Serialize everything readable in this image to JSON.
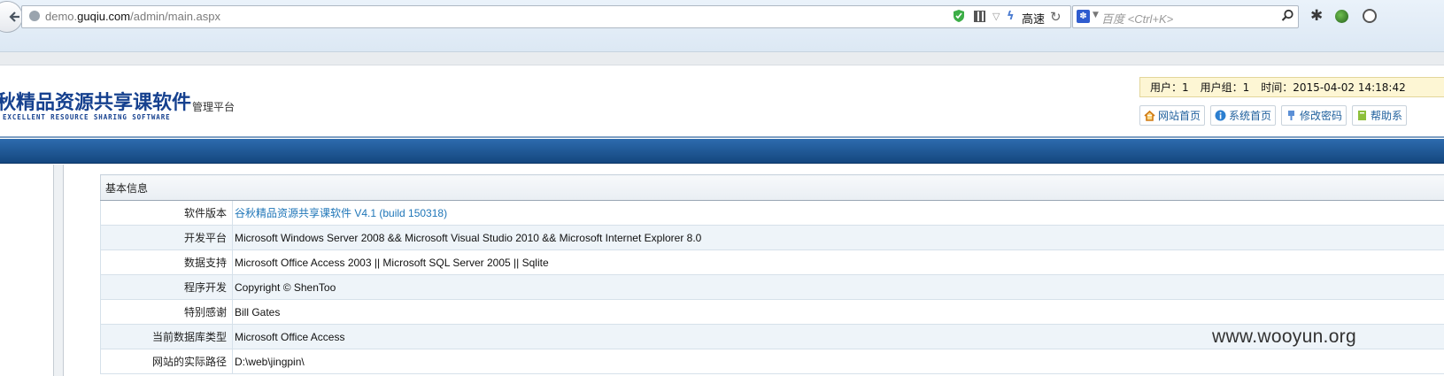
{
  "browser": {
    "url_prefix": "demo.",
    "url_domain": "guqiu.com",
    "url_path": "/admin/main.aspx",
    "speed_label": "高速",
    "search_placeholder": "百度 <Ctrl+K>",
    "icons": [
      "back-arrow-icon",
      "globe-icon",
      "shield-icon",
      "qr-code-icon",
      "speed-icon",
      "reload-icon",
      "baidu-icon",
      "search-icon",
      "gear-icon",
      "green-addon-icon",
      "palette-icon"
    ]
  },
  "header": {
    "logo_cn": "秋精品资源共享课软件",
    "logo_en": "EXCELLENT RESOURCE SHARING SOFTWARE",
    "logo_sub": "管理平台",
    "user": "用户：1",
    "group": "用户组：1",
    "time": "时间：2015-04-02 14:18:42",
    "nav": [
      {
        "label": "网站首页",
        "icon": "home-icon"
      },
      {
        "label": "系统首页",
        "icon": "info-icon"
      },
      {
        "label": "修改密码",
        "icon": "edit-icon"
      },
      {
        "label": "帮助系",
        "icon": "help-icon"
      }
    ]
  },
  "info": {
    "heading": "基本信息",
    "rows": [
      {
        "key": "软件版本",
        "value": "谷秋精品资源共享课软件 V4.1 (build 150318)"
      },
      {
        "key": "开发平台",
        "value": "Microsoft Windows Server 2008 && Microsoft Visual Studio 2010 && Microsoft Internet Explorer 8.0"
      },
      {
        "key": "数据支持",
        "value": "Microsoft Office Access 2003 || Microsoft SQL Server 2005 || Sqlite"
      },
      {
        "key": "程序开发",
        "value": "Copyright © ShenToo"
      },
      {
        "key": "特别感谢",
        "value": "Bill Gates"
      },
      {
        "key": "当前数据库类型",
        "value": "Microsoft Office Access"
      },
      {
        "key": "网站的实际路径",
        "value": "D:\\web\\jingpin\\"
      }
    ]
  },
  "watermark": "www.wooyun.org",
  "colors": {
    "nav_band": "#1c5594",
    "link": "#1f76b8",
    "userinfo_bg": "#fdf6d4"
  }
}
